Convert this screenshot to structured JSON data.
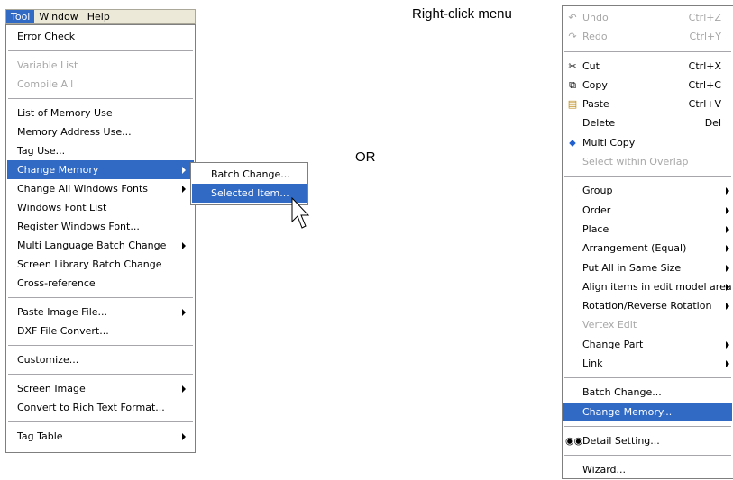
{
  "menubar": {
    "items": [
      "Tool",
      "Window",
      "Help"
    ]
  },
  "tool_menu": {
    "groups": [
      [
        "Error Check"
      ],
      [
        "Variable List",
        "Compile All"
      ],
      [
        "List of Memory Use",
        "Memory Address Use...",
        "Tag Use...",
        "Change Memory",
        "Change All Windows Fonts",
        "Windows Font List",
        "Register Windows Font...",
        "Multi Language Batch Change",
        "Screen Library Batch Change",
        "Cross-reference"
      ],
      [
        "Paste Image File...",
        "DXF File Convert..."
      ],
      [
        "Customize..."
      ],
      [
        "Screen Image",
        "Convert to Rich Text Format..."
      ],
      [
        "Tag Table"
      ]
    ]
  },
  "submenu": {
    "items": [
      "Batch Change...",
      "Selected Item..."
    ]
  },
  "or_label": "OR",
  "rclick_title": "Right-click menu",
  "rclick_menu": {
    "undo": "Undo",
    "undo_sc": "Ctrl+Z",
    "redo": "Redo",
    "redo_sc": "Ctrl+Y",
    "cut": "Cut",
    "cut_sc": "Ctrl+X",
    "copy": "Copy",
    "copy_sc": "Ctrl+C",
    "paste": "Paste",
    "paste_sc": "Ctrl+V",
    "delete": "Delete",
    "delete_sc": "Del",
    "multi_copy": "Multi Copy",
    "select_overlap": "Select within Overlap",
    "group": "Group",
    "order": "Order",
    "place": "Place",
    "arrangement": "Arrangement (Equal)",
    "same_size": "Put All in Same Size",
    "align": "Align items in edit model area",
    "rotation": "Rotation/Reverse Rotation",
    "vertex_edit": "Vertex Edit",
    "change_part": "Change Part",
    "link": "Link",
    "batch_change": "Batch Change...",
    "change_memory": "Change Memory...",
    "detail_setting": "Detail Setting...",
    "wizard": "Wizard..."
  }
}
